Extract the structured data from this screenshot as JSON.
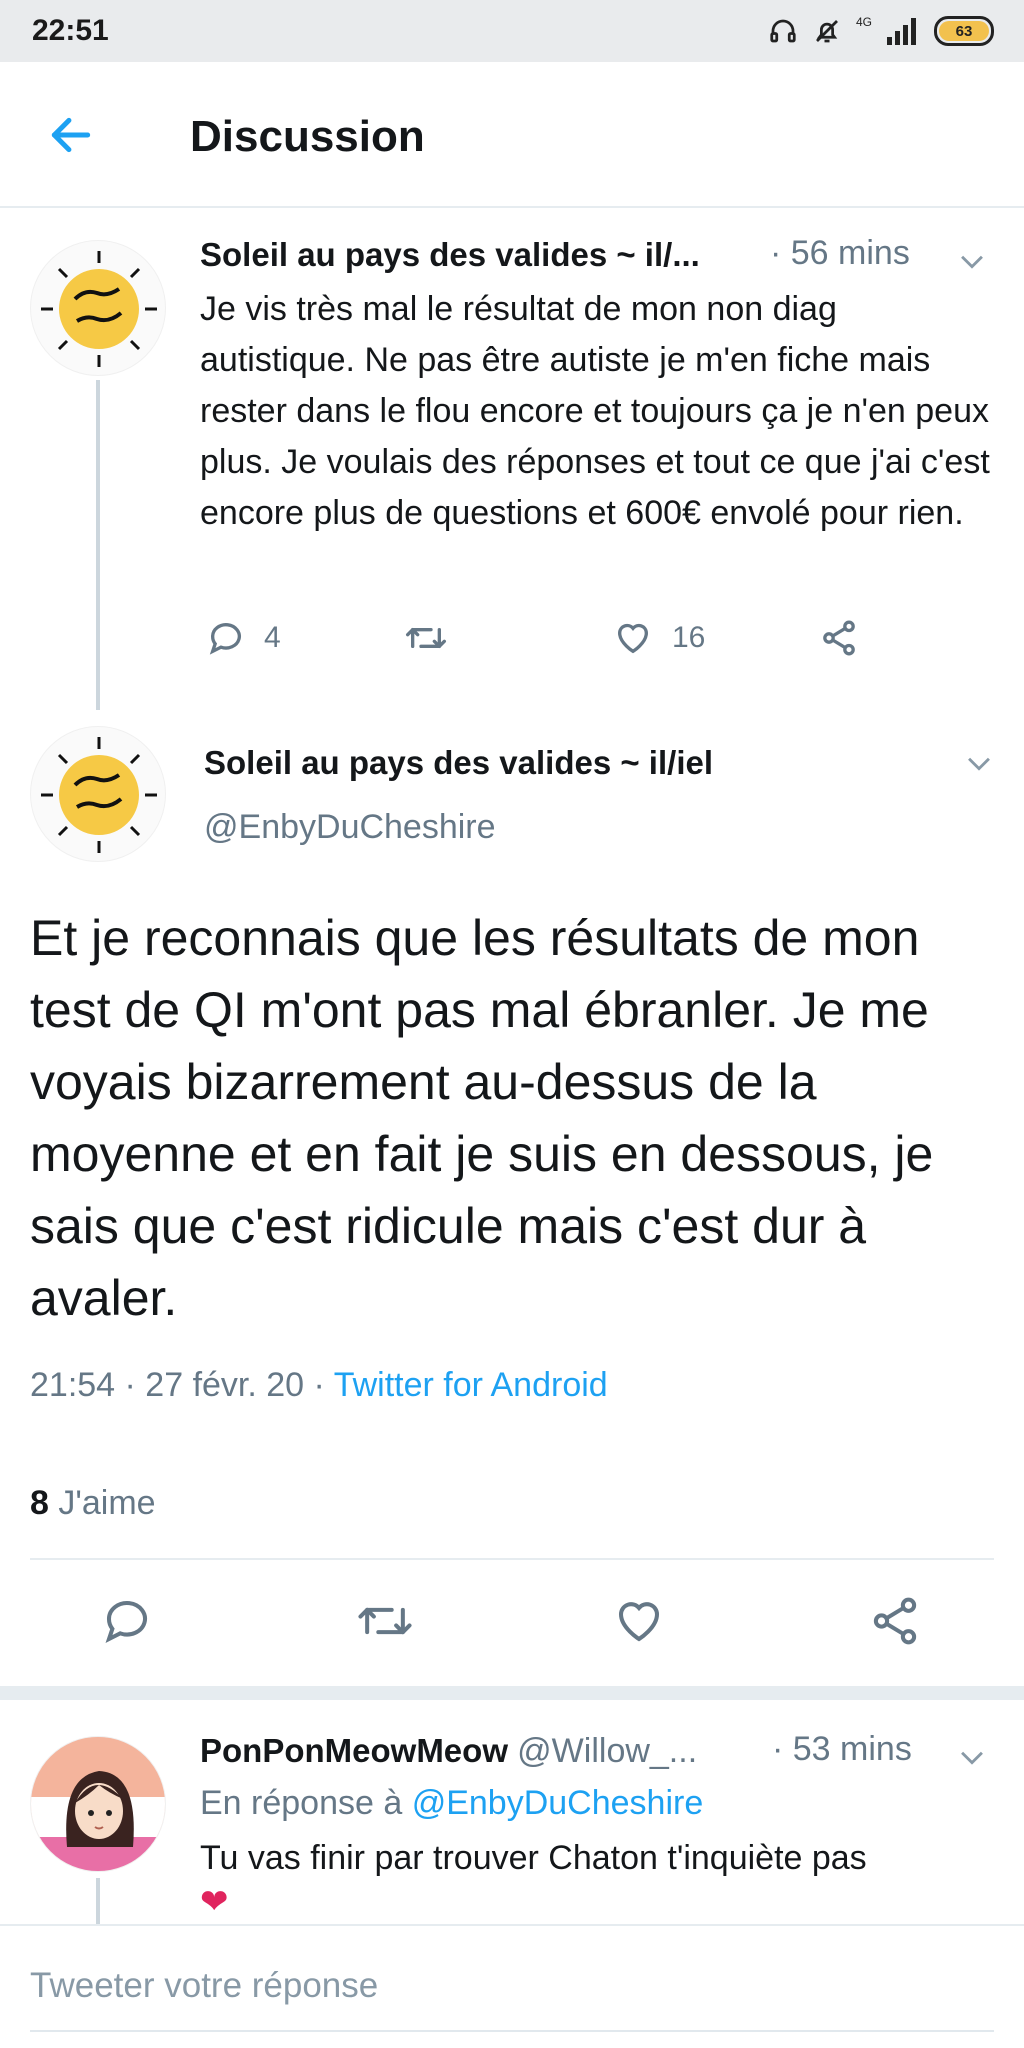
{
  "status_bar": {
    "time": "22:51",
    "network": "4G",
    "battery": "63",
    "icons": [
      "headphones-icon",
      "alarm-off-icon",
      "signal-icon",
      "battery-icon"
    ]
  },
  "header": {
    "title": "Discussion",
    "back_icon": "arrow-left-icon",
    "accent_color": "#1da1f2"
  },
  "tweet1": {
    "name": "Soleil au pays des valides ~ il/...",
    "time": "· 56 mins",
    "text": "Je vis très mal le résultat de mon non diag autistique. Ne pas être autiste je m'en fiche mais rester dans le flou encore et toujours ça je n'en peux plus. Je voulais des réponses et tout ce que j'ai c'est encore plus de questions et 600€ envolé pour rien.",
    "replies": "4",
    "likes": "16"
  },
  "main_tweet": {
    "name": "Soleil au pays des valides ~ il/iel",
    "handle": "@EnbyDuCheshire",
    "text": "Et je reconnais que les résultats de mon test de QI m'ont pas mal ébranler. Je me voyais bizarrement au-dessus de la moyenne et en fait je suis en dessous, je sais que c'est ridicule mais c'est dur à avaler.",
    "timestamp": "21:54 · 27 févr. 20 · ",
    "source": "Twitter for Android",
    "likes_count": "8",
    "likes_label": "J'aime"
  },
  "reply_tweet": {
    "name": "PonPonMeowMeow",
    "handle": "@Willow_...",
    "time": "· 53 mins",
    "reply_prefix": "En réponse à ",
    "reply_to": "@EnbyDuCheshire",
    "text": "Tu vas finir par trouver Chaton t'inquiète pas",
    "emoji": "❤"
  },
  "compose": {
    "placeholder": "Tweeter votre réponse"
  }
}
